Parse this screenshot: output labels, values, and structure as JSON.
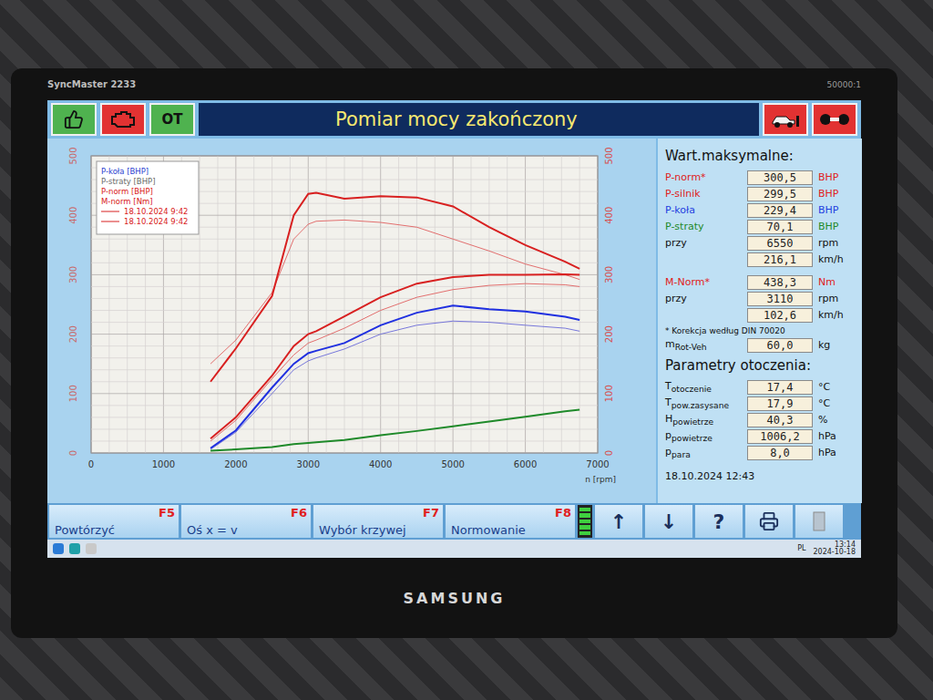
{
  "monitor": {
    "model": "SyncMaster 2233",
    "contrast": "50000:1",
    "brand": "SAMSUNG"
  },
  "toolbar": {
    "title": "Pomiar mocy zakończony",
    "ot_label": "OT"
  },
  "chart": {
    "left_ticks": [
      "0",
      "100",
      "200",
      "300",
      "400",
      "500"
    ],
    "right_ticks": [
      "0",
      "100",
      "200",
      "300",
      "400",
      "500"
    ],
    "x_ticks": [
      "0",
      "1000",
      "2000",
      "3000",
      "4000",
      "5000",
      "6000",
      "7000"
    ],
    "x_label": "n [rpm]",
    "legend": [
      {
        "label": "P-koła [BHP]",
        "color": "#2b3fd0",
        "kind": "text"
      },
      {
        "label": "P-straty [BHP]",
        "color": "#6a6a6a",
        "kind": "text"
      },
      {
        "label": "P-norm [BHP]",
        "color": "#d82020",
        "kind": "text"
      },
      {
        "label": "M-norm [Nm]",
        "color": "#d82020",
        "kind": "text"
      },
      {
        "label": "18.10.2024 9:42",
        "color": "#d82020",
        "kind": "line"
      },
      {
        "label": "18.10.2024 9:42",
        "color": "#d82020",
        "kind": "line"
      }
    ],
    "rpm": [
      1650,
      2000,
      2500,
      2800,
      3000,
      3110,
      3500,
      4000,
      4500,
      5000,
      5500,
      6000,
      6550,
      6750
    ],
    "series": [
      {
        "name": "M-norm ref",
        "color": "#e06060",
        "kind": "reference",
        "values": [
          150,
          190,
          270,
          360,
          385,
          390,
          392,
          388,
          380,
          360,
          340,
          318,
          300,
          292
        ]
      },
      {
        "name": "P-norm ref",
        "color": "#e06060",
        "kind": "reference",
        "values": [
          20,
          55,
          125,
          165,
          185,
          190,
          210,
          240,
          262,
          275,
          282,
          285,
          283,
          280
        ]
      },
      {
        "name": "P-koła ref",
        "color": "#6a6ad8",
        "kind": "reference",
        "values": [
          6,
          35,
          100,
          140,
          155,
          160,
          175,
          200,
          215,
          222,
          220,
          215,
          210,
          205
        ]
      },
      {
        "name": "P-straty",
        "color": "#1f8a2a",
        "kind": "main",
        "values": [
          4,
          6,
          10,
          15,
          17,
          18,
          22,
          30,
          37,
          45,
          53,
          61,
          70.1,
          73
        ]
      },
      {
        "name": "P-koła",
        "color": "#2030e0",
        "kind": "main",
        "values": [
          8,
          38,
          110,
          150,
          168,
          172,
          185,
          215,
          236,
          248,
          242,
          238,
          229.4,
          224
        ]
      },
      {
        "name": "P-norm",
        "color": "#d82020",
        "kind": "main",
        "values": [
          24,
          60,
          130,
          180,
          200,
          205,
          230,
          262,
          285,
          296,
          300,
          300,
          300.5,
          300
        ]
      },
      {
        "name": "M-norm",
        "color": "#d82020",
        "kind": "main",
        "values": [
          120,
          176,
          264,
          400,
          436,
          438,
          428,
          432,
          430,
          415,
          380,
          350,
          322,
          310
        ]
      }
    ]
  },
  "max_values": {
    "title": "Wart.maksymalne:",
    "power": [
      {
        "label": "P-norm*",
        "value": "300,5",
        "unit": "BHP",
        "color": "#e02020"
      },
      {
        "label": "P-silnik",
        "value": "299,5",
        "unit": "BHP",
        "color": "#e02020"
      },
      {
        "label": "P-koła",
        "value": "229,4",
        "unit": "BHP",
        "color": "#1f3fe0"
      },
      {
        "label": "P-straty",
        "value": "70,1",
        "unit": "BHP",
        "color": "#1f8a2a"
      },
      {
        "label": "przy",
        "value": "6550",
        "unit": "rpm",
        "color": "#111111"
      },
      {
        "label": "",
        "value": "216,1",
        "unit": "km/h",
        "color": "#111111"
      }
    ],
    "torque": [
      {
        "label": "M-Norm*",
        "value": "438,3",
        "unit": "Nm",
        "color": "#e02020"
      },
      {
        "label": "przy",
        "value": "3110",
        "unit": "rpm",
        "color": "#111111"
      },
      {
        "label": "",
        "value": "102,6",
        "unit": "km/h",
        "color": "#111111"
      }
    ],
    "note": "* Korekcja według DIN 70020",
    "mass": {
      "label": "m",
      "sub": "Rot-Veh",
      "value": "60,0",
      "unit": "kg"
    }
  },
  "ambient": {
    "title": "Parametry otoczenia:",
    "rows": [
      {
        "label": "T",
        "sub": "otoczenie",
        "value": "17,4",
        "unit": "°C"
      },
      {
        "label": "T",
        "sub": "pow.zasysane",
        "value": "17,9",
        "unit": "°C"
      },
      {
        "label": "H",
        "sub": "powietrze",
        "value": "40,3",
        "unit": "%"
      },
      {
        "label": "p",
        "sub": "powietrze",
        "value": "1006,2",
        "unit": "hPa"
      },
      {
        "label": "p",
        "sub": "para",
        "value": "8,0",
        "unit": "hPa"
      }
    ]
  },
  "timestamp": "18.10.2024 12:43",
  "function_keys": [
    {
      "label": "Powtórzyć",
      "key": "F5"
    },
    {
      "label": "Oś x = v",
      "key": "F6"
    },
    {
      "label": "Wybór krzywej",
      "key": "F7"
    },
    {
      "label": "Normowanie",
      "key": "F8"
    }
  ],
  "signal_level": 1,
  "nav_buttons": [
    {
      "label": "↑",
      "disabled": false
    },
    {
      "label": "↓",
      "disabled": false
    },
    {
      "label": "?",
      "disabled": false
    }
  ],
  "taskbar": {
    "lang": "PL",
    "time": "13:14",
    "date": "2024-10-18"
  }
}
